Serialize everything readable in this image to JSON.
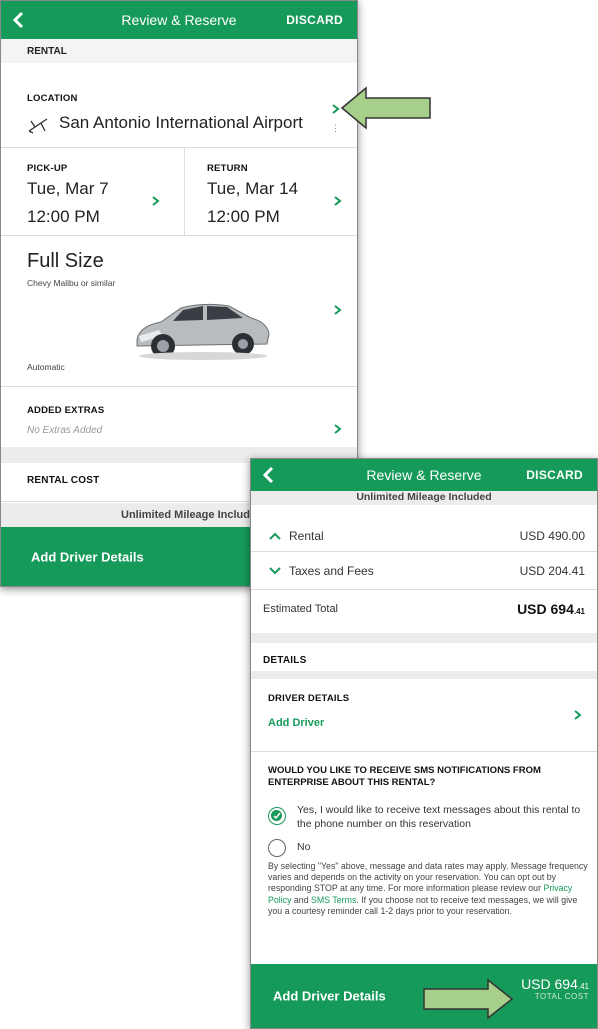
{
  "screen1": {
    "header": {
      "title": "Review & Reserve",
      "discard": "DISCARD"
    },
    "rental_section": "RENTAL",
    "location": {
      "label": "LOCATION",
      "value": "San Antonio International Airport"
    },
    "pickup": {
      "label": "PICK-UP",
      "date": "Tue, Mar 7",
      "time": "12:00 PM"
    },
    "return": {
      "label": "RETURN",
      "date": "Tue, Mar 14",
      "time": "12:00 PM"
    },
    "vehicle": {
      "class": "Full Size",
      "model": "Chevy Malibu or similar",
      "transmission": "Automatic"
    },
    "extras": {
      "label": "ADDED EXTRAS",
      "value": "No Extras Added"
    },
    "rental_cost": "RENTAL COST",
    "mileage": "Unlimited Mileage Include",
    "cta": "Add Driver Details"
  },
  "screen2": {
    "header": {
      "title": "Review & Reserve",
      "discard": "DISCARD"
    },
    "mileage": "Unlimited Mileage Included",
    "rental": {
      "label": "Rental",
      "value": "USD 490.00"
    },
    "taxes": {
      "label": "Taxes and Fees",
      "value": "USD 204.41"
    },
    "estimated": {
      "label": "Estimated Total",
      "value_main": "USD 694",
      "value_cents": ".41"
    },
    "details_section": "DETAILS",
    "driver": {
      "label": "DRIVER DETAILS",
      "action": "Add Driver"
    },
    "sms": {
      "question": "WOULD YOU LIKE TO RECEIVE SMS NOTIFICATIONS FROM ENTERPRISE ABOUT THIS RENTAL?",
      "yes": "Yes, I would like to receive text messages about this rental to the phone number on this reservation",
      "no": "No",
      "disclaimer_1": "By selecting \"Yes\" above, message and data rates may apply. Message frequency varies and depends on the activity on your reservation. You can opt out by responding STOP at any time. For more information please review our ",
      "privacy": "Privacy Policy",
      "and": " and ",
      "sms_terms": "SMS Terms",
      "disclaimer_2": ". If you choose not to receive text messages, we will give you a courtesy reminder call 1-2 days prior to your reservation."
    },
    "cta": "Add Driver Details",
    "total": {
      "main": "USD 694",
      "cents": ".41",
      "label": "TOTAL COST"
    }
  },
  "colors": {
    "brand_green": "#169A5A",
    "arrow_green": "#A5CF8A"
  }
}
